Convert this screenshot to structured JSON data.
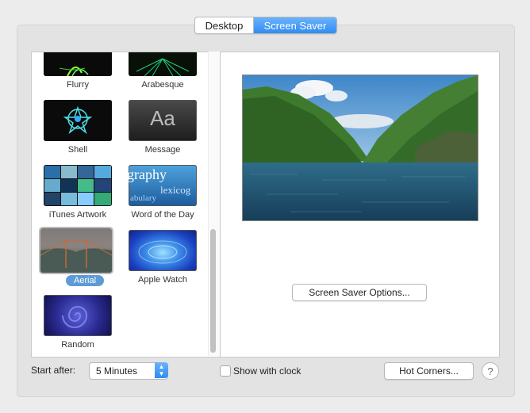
{
  "tabs": [
    {
      "label": "Desktop",
      "selected": false
    },
    {
      "label": "Screen Saver",
      "selected": true
    }
  ],
  "savers": [
    {
      "name": "Flurry",
      "icon": "flurry-thumbnail"
    },
    {
      "name": "Arabesque",
      "icon": "arabesque-thumbnail"
    },
    {
      "name": "Shell",
      "icon": "shell-thumbnail"
    },
    {
      "name": "Message",
      "icon": "message-thumbnail",
      "glyph": "Aa"
    },
    {
      "name": "iTunes Artwork",
      "icon": "itunes-artwork-thumbnail"
    },
    {
      "name": "Word of the Day",
      "icon": "word-of-the-day-thumbnail",
      "words": [
        "graphy",
        "lexicog",
        "abulary"
      ]
    },
    {
      "name": "Aerial",
      "icon": "aerial-thumbnail",
      "selected": true
    },
    {
      "name": "Apple Watch",
      "icon": "apple-watch-thumbnail"
    },
    {
      "name": "Random",
      "icon": "random-thumbnail"
    }
  ],
  "options_button": "Screen Saver Options...",
  "start_after": {
    "label": "Start after:",
    "value": "5 Minutes"
  },
  "show_clock": {
    "label": "Show with clock",
    "checked": false
  },
  "hot_corners_button": "Hot Corners...",
  "help": "?",
  "colors": {
    "accent": "#3d93f4",
    "selection": "#5e9bd6"
  }
}
